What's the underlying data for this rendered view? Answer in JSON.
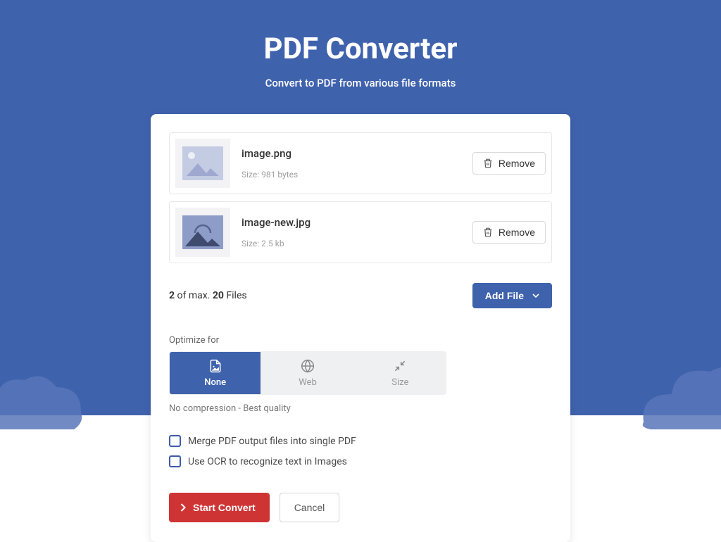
{
  "header": {
    "title": "PDF Converter",
    "subtitle": "Convert to PDF from various file formats"
  },
  "files": [
    {
      "name": "image.png",
      "size_label": "Size: 981 bytes",
      "thumb_variant": "light"
    },
    {
      "name": "image-new.jpg",
      "size_label": "Size: 2.5 kb",
      "thumb_variant": "dark"
    }
  ],
  "file_count": {
    "current": "2",
    "mid": " of max. ",
    "max": "20",
    "suffix": " Files"
  },
  "buttons": {
    "remove": "Remove",
    "add_file": "Add File",
    "start": "Start Convert",
    "cancel": "Cancel"
  },
  "optimize": {
    "label": "Optimize for",
    "tabs": [
      {
        "id": "none",
        "label": "None",
        "active": true
      },
      {
        "id": "web",
        "label": "Web",
        "active": false
      },
      {
        "id": "size",
        "label": "Size",
        "active": false
      }
    ],
    "desc": "No compression - Best quality"
  },
  "checkboxes": [
    {
      "id": "merge",
      "label": "Merge PDF output files into single PDF",
      "checked": false
    },
    {
      "id": "ocr",
      "label": "Use OCR to recognize text in Images",
      "checked": false
    }
  ]
}
